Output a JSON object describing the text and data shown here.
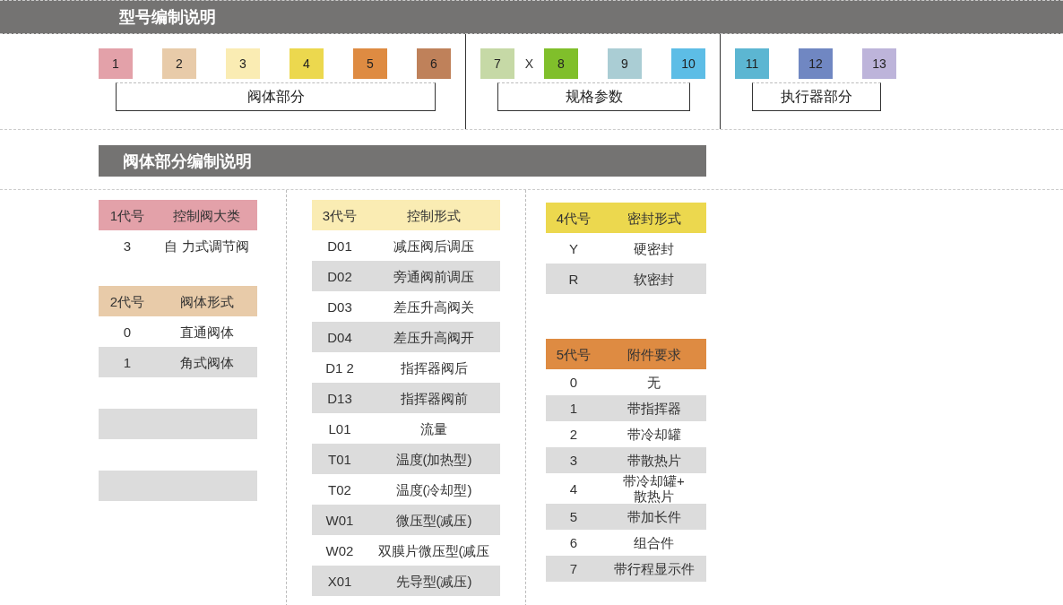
{
  "title": "型号编制说明",
  "code_groups": [
    {
      "label": "阀体部分",
      "codes": [
        {
          "kind": "code",
          "text": "1",
          "color": "#e3a1a9"
        },
        {
          "kind": "code",
          "text": "2",
          "color": "#e8cba9"
        },
        {
          "kind": "code",
          "text": "3",
          "color": "#faecb3"
        },
        {
          "kind": "code",
          "text": "4",
          "color": "#ecd84e"
        },
        {
          "kind": "code",
          "text": "5",
          "color": "#de8b42"
        },
        {
          "kind": "code",
          "text": "6",
          "color": "#bf815a"
        }
      ]
    },
    {
      "label": "规格参数",
      "codes": [
        {
          "kind": "code",
          "text": "7",
          "color": "#c6d9a6"
        },
        {
          "kind": "separator",
          "text": "X"
        },
        {
          "kind": "code",
          "text": "8",
          "color": "#80bf2b"
        },
        {
          "kind": "code",
          "text": "9",
          "color": "#aacdd4"
        },
        {
          "kind": "code",
          "text": "10",
          "color": "#5dbde6"
        }
      ]
    },
    {
      "label": "执行器部分",
      "codes": [
        {
          "kind": "code",
          "text": "11",
          "color": "#5cb6d2"
        },
        {
          "kind": "code",
          "text": "12",
          "color": "#7087c2"
        },
        {
          "kind": "code",
          "text": "13",
          "color": "#bdb4da"
        }
      ]
    }
  ],
  "section": {
    "title": "阀体部分编制说明",
    "columns": [
      {
        "tables": [
          {
            "headers": [
              "1代号",
              "控制阀大类"
            ],
            "color": "#e3a1a9",
            "rows": [
              [
                "3",
                "自 力式调节阀"
              ]
            ]
          },
          {
            "headers": [
              "2代号",
              "阀体形式"
            ],
            "color": "#e8cba9",
            "rows": [
              [
                "0",
                "直通阀体"
              ],
              [
                "1",
                "角式阀体"
              ]
            ]
          }
        ]
      },
      {
        "tables": [
          {
            "headers": [
              "3代号",
              "控制形式"
            ],
            "color": "#faecb3",
            "rows": [
              [
                "D01",
                "减压阀后调压"
              ],
              [
                "D02",
                "旁通阀前调压"
              ],
              [
                "D03",
                "差压升高阀关"
              ],
              [
                "D04",
                "差压升高阀开"
              ],
              [
                "D1 2",
                "指挥器阀后"
              ],
              [
                "D13",
                "指挥器阀前"
              ],
              [
                "L01",
                "流量"
              ],
              [
                "T01",
                "温度(加热型)"
              ],
              [
                "T02",
                "温度(冷却型)"
              ],
              [
                "W01",
                "微压型(减压)"
              ],
              [
                "W02",
                "双膜片微压型(减压"
              ],
              [
                "X01",
                "先导型(减压)"
              ]
            ]
          }
        ]
      },
      {
        "tables": [
          {
            "headers": [
              "4代号",
              "密封形式"
            ],
            "color": "#ecd84e",
            "rows": [
              [
                "Y",
                "硬密封"
              ],
              [
                "R",
                "软密封"
              ]
            ]
          },
          {
            "headers": [
              "5代号",
              "附件要求"
            ],
            "color": "#de8b42",
            "rows": [
              [
                "0",
                "无"
              ],
              [
                "1",
                "带指挥器"
              ],
              [
                "2",
                "带冷却罐"
              ],
              [
                "3",
                "带散热片"
              ],
              [
                "4",
                "带冷却罐+\n散热片"
              ],
              [
                "5",
                "带加长件"
              ],
              [
                "6",
                "组合件"
              ],
              [
                "7",
                "带行程显示件"
              ]
            ]
          }
        ]
      }
    ]
  }
}
